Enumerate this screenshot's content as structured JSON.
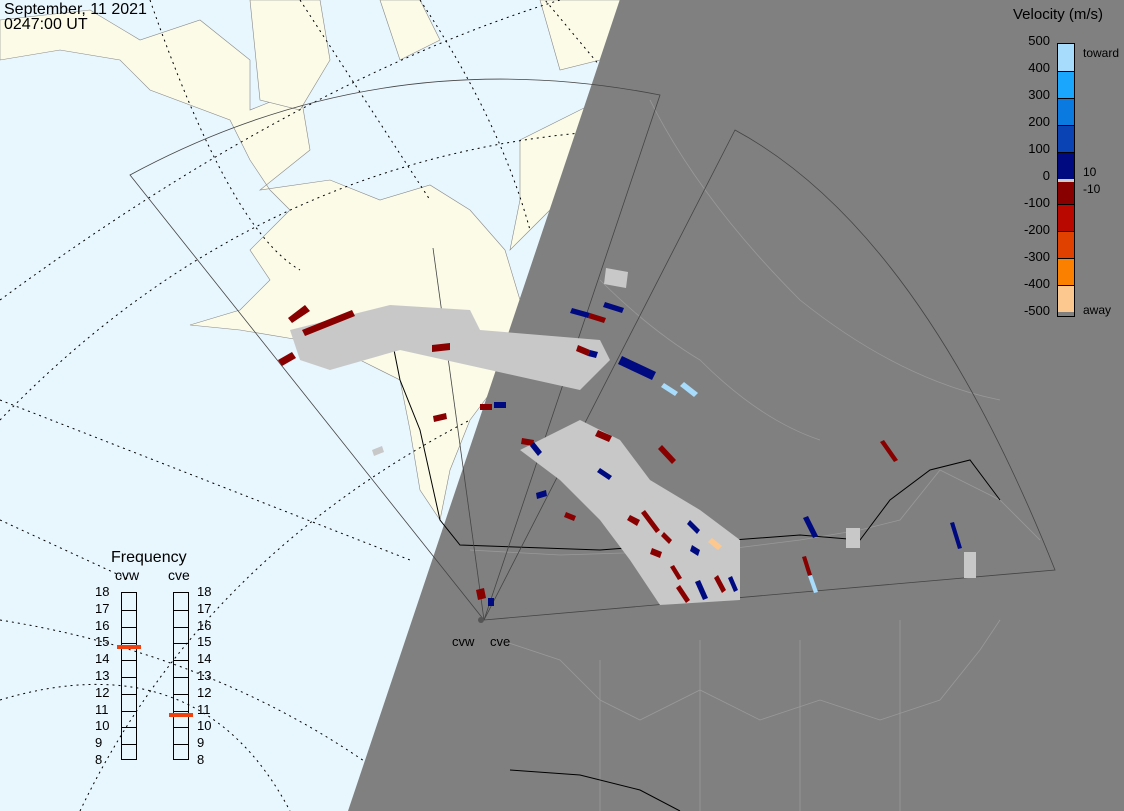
{
  "header": {
    "date": "September, 11 2021",
    "time": "0247:00 UT"
  },
  "colorbar": {
    "title": "Velocity (m/s)",
    "ticks": [
      "500",
      "400",
      "300",
      "200",
      "100",
      "0",
      "-100",
      "-200",
      "-300",
      "-400",
      "-500"
    ],
    "toward_label": "toward",
    "away_label": "away",
    "pos_threshold": "10",
    "neg_threshold": "-10",
    "colors": [
      "#a8dcfc",
      "#1aa6fc",
      "#0a7ae0",
      "#0a44b4",
      "#000a80",
      "#880000",
      "#b80800",
      "#e04000",
      "#fc8000",
      "#fcc890"
    ]
  },
  "frequency": {
    "title": "Frequency",
    "radars": [
      {
        "name": "cvw",
        "value_mhz": 14.7
      },
      {
        "name": "cve",
        "value_mhz": 10.7
      }
    ],
    "ticks": [
      "18",
      "17",
      "16",
      "15",
      "14",
      "13",
      "12",
      "11",
      "10",
      "9",
      "8"
    ],
    "marker_color": "#f04010"
  },
  "map": {
    "radar_labels": [
      "cvw",
      "cve"
    ],
    "colors": {
      "ocean": "#e8f6fe",
      "land": "#fbfbe8",
      "night": "#808080",
      "ground_scatter": "#c8c8c8"
    }
  }
}
